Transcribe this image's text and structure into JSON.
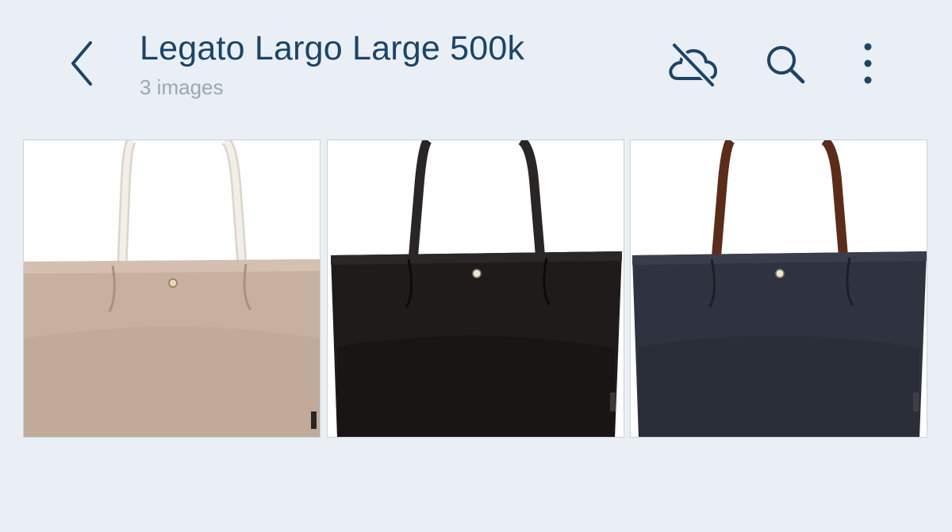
{
  "header": {
    "back_icon": "chevron-left-icon",
    "title": "Legato Largo Large 500k",
    "subtitle": "3 images",
    "actions": [
      {
        "name": "cloud-off-icon"
      },
      {
        "name": "search-icon"
      },
      {
        "name": "more-vertical-icon"
      }
    ]
  },
  "colors": {
    "background": "#e9eff4",
    "title": "#1c4468",
    "subtitle": "#9aa8b4",
    "icon": "#1c4468"
  },
  "images": [
    {
      "subject": "tote-bag",
      "body_color": "#c9b2a2",
      "handle_color": "#ece9e0"
    },
    {
      "subject": "tote-bag",
      "body_color": "#1e1a19",
      "handle_color": "#262322"
    },
    {
      "subject": "tote-bag",
      "body_color": "#2f3340",
      "handle_color": "#5a2c1a"
    }
  ]
}
